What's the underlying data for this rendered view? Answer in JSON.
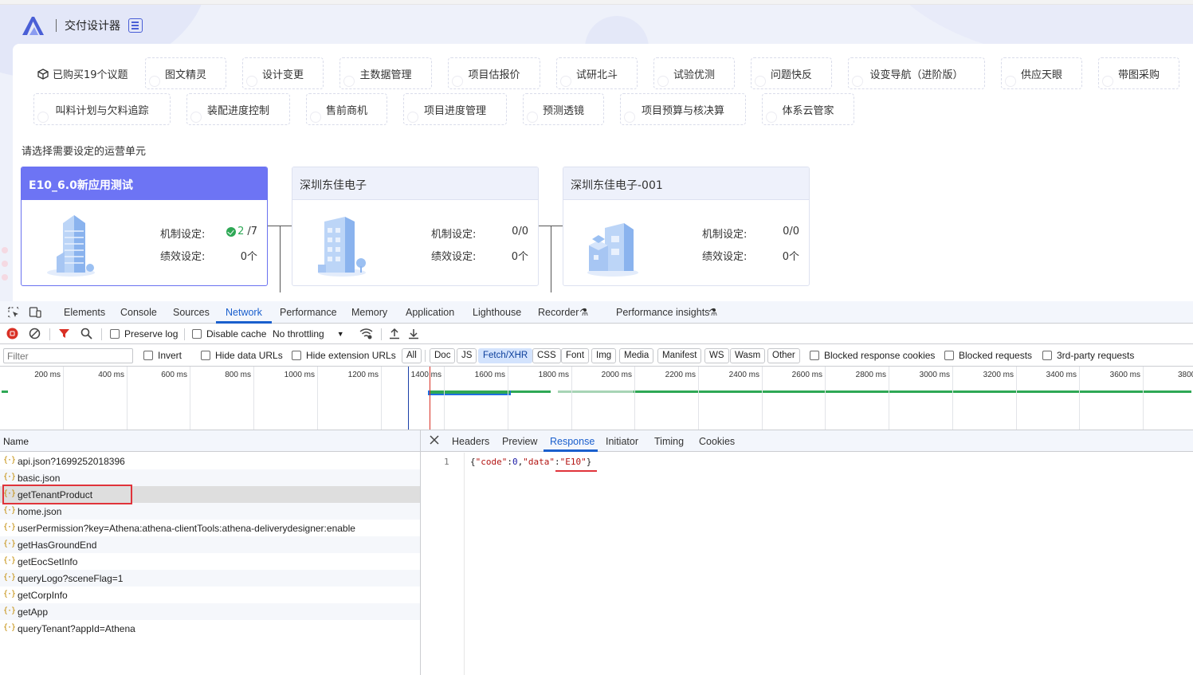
{
  "app": {
    "title": "交付设计器",
    "purchased": "已购买19个议题",
    "tags_row1": [
      "图文精灵",
      "设计变更",
      "主数据管理",
      "项目估报价",
      "试研北斗",
      "试验优测",
      "问题快反",
      "设变导航（进阶版）",
      "供应天眼",
      "带图采购"
    ],
    "tags_row2": [
      "叫料计划与欠料追踪",
      "装配进度控制",
      "售前商机",
      "项目进度管理",
      "预测透镜",
      "项目预算与核决算",
      "体系云管家"
    ],
    "select_label": "请选择需要设定的运营单元",
    "units": [
      {
        "name": "E10_6.0新应用测试",
        "mech_label": "机制设定:",
        "mech_ok": "2",
        "mech_value": "/7",
        "perf_label": "绩效设定:",
        "perf_value": "0个"
      },
      {
        "name": "深圳东佳电子",
        "mech_label": "机制设定:",
        "mech_value": "0/0",
        "perf_label": "绩效设定:",
        "perf_value": "0个"
      },
      {
        "name": "深圳东佳电子-001",
        "mech_label": "机制设定:",
        "mech_value": "0/0",
        "perf_label": "绩效设定:",
        "perf_value": "0个"
      }
    ],
    "colors": {
      "accent": "#6d74f4",
      "ok": "#2ea855"
    }
  },
  "devtools": {
    "tabs": [
      "Elements",
      "Console",
      "Sources",
      "Network",
      "Performance",
      "Memory",
      "Application",
      "Lighthouse",
      "Recorder",
      "Performance insights"
    ],
    "active_tab": "Network",
    "toolbar": {
      "preserve_log": "Preserve log",
      "disable_cache": "Disable cache",
      "throttling": "No throttling"
    },
    "filter": {
      "placeholder": "Filter",
      "invert": "Invert",
      "hide_data_urls": "Hide data URLs",
      "hide_extension_urls": "Hide extension URLs",
      "types": [
        "All",
        "Doc",
        "JS",
        "Fetch/XHR",
        "CSS",
        "Font",
        "Img",
        "Media",
        "Manifest",
        "WS",
        "Wasm",
        "Other"
      ],
      "active_type": "Fetch/XHR",
      "blocked_cookies": "Blocked response cookies",
      "blocked_requests": "Blocked requests",
      "third_party": "3rd-party requests"
    },
    "timeline_ticks": [
      "200 ms",
      "400 ms",
      "600 ms",
      "800 ms",
      "1000 ms",
      "1200 ms",
      "1400 ms",
      "1600 ms",
      "1800 ms",
      "2000 ms",
      "2200 ms",
      "2400 ms",
      "2600 ms",
      "2800 ms",
      "3000 ms",
      "3200 ms",
      "3400 ms",
      "3600 ms",
      "3800"
    ],
    "name_header": "Name",
    "requests": [
      "api.json?1699252018396",
      "basic.json",
      "getTenantProduct",
      "home.json",
      "userPermission?key=Athena:athena-clientTools:athena-deliverydesigner:enable",
      "getHasGroundEnd",
      "getEocSetInfo",
      "queryLogo?sceneFlag=1",
      "getCorpInfo",
      "getApp",
      "queryTenant?appId=Athena"
    ],
    "selected_request": "getTenantProduct",
    "detail_tabs": [
      "Headers",
      "Preview",
      "Response",
      "Initiator",
      "Timing",
      "Cookies"
    ],
    "active_detail_tab": "Response",
    "response": {
      "line_number": "1",
      "open": "{",
      "k1": "\"code\"",
      "colon1": ":",
      "v1": "0",
      "comma": ",",
      "k2": "\"data\"",
      "colon2": ":",
      "v2": "\"E10\"",
      "close": "}"
    }
  }
}
